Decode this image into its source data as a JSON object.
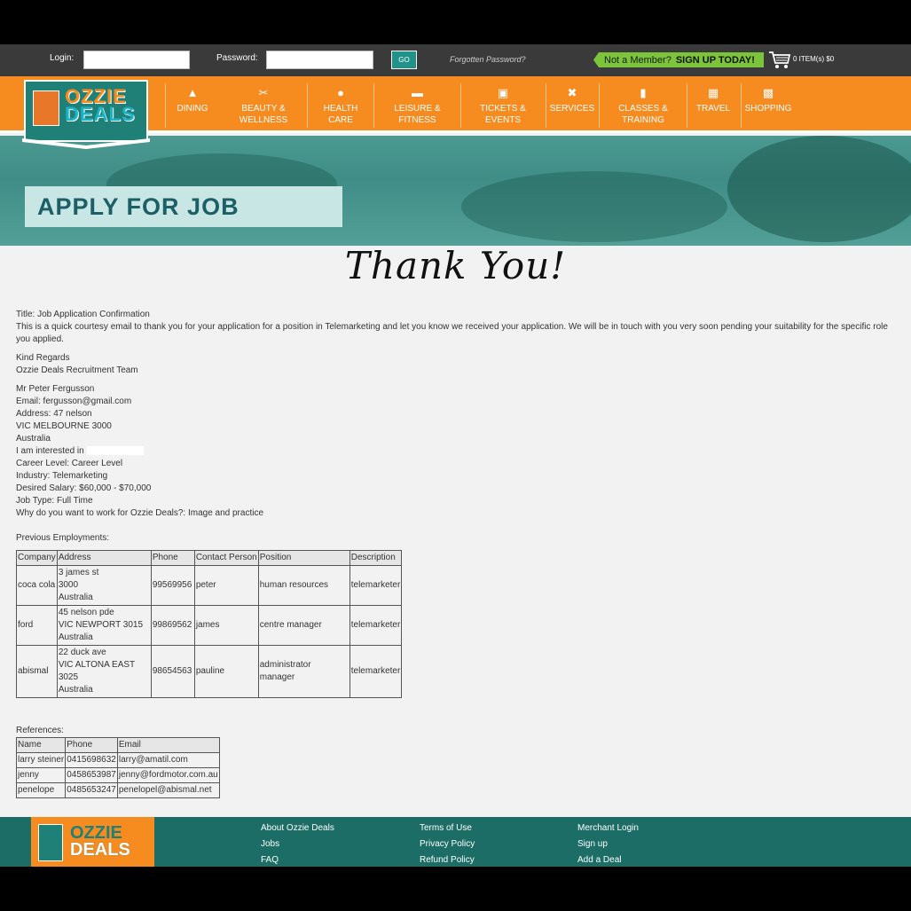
{
  "topbar": {
    "login_label": "Login:",
    "password_label": "Password:",
    "go_label": "GO",
    "forgot_label": "Forgotten Password?",
    "member_text": "Not a Member?",
    "signup_text": "SIGN UP TODAY!",
    "cart_text": "0 ITEM(s) $0"
  },
  "logo": {
    "line1": "OZZIE",
    "line2": "DEALS"
  },
  "nav": [
    {
      "icon": "dining-icon",
      "label": "DINING"
    },
    {
      "icon": "scissors-icon",
      "label": "BEAUTY & WELLNESS"
    },
    {
      "icon": "drop-icon",
      "label": "HEALTH CARE"
    },
    {
      "icon": "shoe-icon",
      "label": "LEISURE & FITNESS"
    },
    {
      "icon": "ticket-icon",
      "label": "TICKETS & EVENTS"
    },
    {
      "icon": "tools-icon",
      "label": "SERVICES"
    },
    {
      "icon": "classes-icon",
      "label": "CLASSES & TRAINING"
    },
    {
      "icon": "suitcase-icon",
      "label": "TRAVEL"
    },
    {
      "icon": "basket-icon",
      "label": "SHOPPING"
    }
  ],
  "hero": {
    "title": "APPLY FOR JOB"
  },
  "thanks": "Thank You!",
  "content": {
    "title_line": "Title: Job Application Confirmation",
    "body": "This is a quick courtesy email to thank you for your application for a position in Telemarketing and let you know we received your application. We will be in touch with you very soon pending your suitability for the specific role you applied.",
    "regards1": "Kind Regards",
    "regards2": "Ozzie Deals Recruitment Team",
    "name": "Mr Peter Fergusson",
    "email": "Email: fergusson@gmail.com",
    "address1": "Address: 47 nelson",
    "address2": "VIC MELBOURNE 3000",
    "address3": "Australia",
    "interested": "I am interested in",
    "career": "Career Level: Career Level",
    "industry": "Industry: Telemarketing",
    "salary": "Desired Salary: $60,000 - $70,000",
    "jobtype": "Job Type: Full Time",
    "why": "Why do you want to work for Ozzie Deals?: Image and practice",
    "prev_label": "Previous Employments:",
    "ref_label": "References:"
  },
  "employments": {
    "headers": [
      "Company",
      "Address",
      "Phone",
      "Contact Person",
      "Position",
      "Description"
    ],
    "rows": [
      {
        "company": "coca cola",
        "addr1": "3 james st",
        "addr2": "3000",
        "addr3": "Australia",
        "phone": "99569956",
        "contact": "peter",
        "position": "human resources",
        "desc": "telemarketer"
      },
      {
        "company": "ford",
        "addr1": "45 nelson pde",
        "addr2": "VIC NEWPORT 3015",
        "addr3": "Australia",
        "phone": "99869562",
        "contact": "james",
        "position": "centre manager",
        "desc": "telemarketer"
      },
      {
        "company": "abismal",
        "addr1": "22 duck ave",
        "addr2": "VIC ALTONA EAST 3025",
        "addr3": "Australia",
        "phone": "98654563",
        "contact": "pauline",
        "position": "administrator manager",
        "desc": "telemarketer"
      }
    ]
  },
  "references": {
    "headers": [
      "Name",
      "Phone",
      "Email"
    ],
    "rows": [
      {
        "name": "larry steiner",
        "phone": "0415698632",
        "email": "larry@amatil.com"
      },
      {
        "name": "jenny",
        "phone": "0458653987",
        "email": "jenny@fordmotor.com.au"
      },
      {
        "name": "penelope",
        "phone": "0485653247",
        "email": "penelopel@abismal.net"
      }
    ]
  },
  "footer": {
    "col1": [
      "About Ozzie Deals",
      "Jobs",
      "FAQ"
    ],
    "col2": [
      "Terms of Use",
      "Privacy Policy",
      "Refund Policy"
    ],
    "col3": [
      "Merchant Login",
      "Sign up",
      "Add a Deal"
    ]
  },
  "colors": {
    "orange": "#f68b1f",
    "teal": "#1f8078",
    "footer": "#1b6d66",
    "signup_green": "#7cc43a"
  }
}
